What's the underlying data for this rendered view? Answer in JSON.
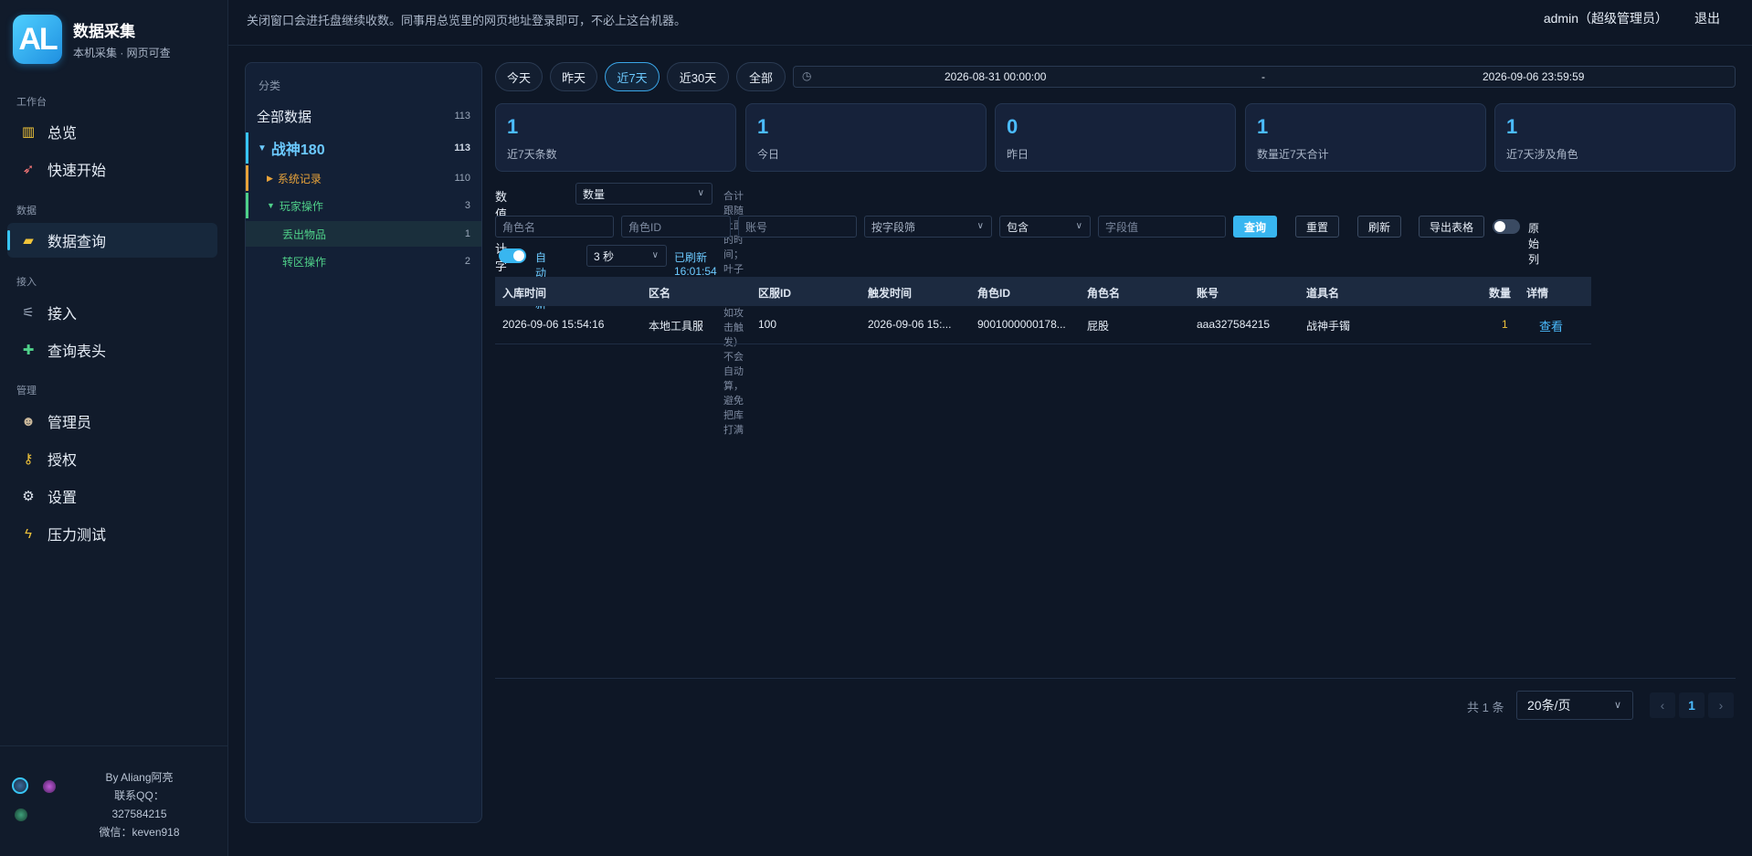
{
  "brand": {
    "logo": "AL",
    "title": "数据采集",
    "subtitle": "本机采集 · 网页可查"
  },
  "sidebar": {
    "groups": [
      "工作台",
      "数据",
      "接入",
      "管理"
    ],
    "items": [
      {
        "label": "总览",
        "icon": "bar-chart-icon"
      },
      {
        "label": "快速开始",
        "icon": "rocket-icon"
      },
      {
        "label": "数据查询",
        "icon": "folder-icon"
      },
      {
        "label": "接入",
        "icon": "plug-icon"
      },
      {
        "label": "查询表头",
        "icon": "puzzle-icon"
      },
      {
        "label": "管理员",
        "icon": "user-icon"
      },
      {
        "label": "授权",
        "icon": "key-icon"
      },
      {
        "label": "设置",
        "icon": "gear-icon"
      },
      {
        "label": "压力测试",
        "icon": "lightning-icon"
      }
    ],
    "footer": {
      "author": "By Aliang阿亮",
      "qq_label": "联系QQ：",
      "qq": "327584215",
      "wechat": "微信：keven918"
    }
  },
  "topbar": {
    "notice": "关闭窗口会进托盘继续收数。同事用总览里的网页地址登录即可，不必上这台机器。",
    "user": "admin（超级管理员）",
    "logout": "退出"
  },
  "categories": {
    "header": "分类",
    "items": [
      {
        "label": "全部数据",
        "count": "113"
      },
      {
        "label": "战神180",
        "count": "113"
      },
      {
        "label": "系统记录",
        "count": "110"
      },
      {
        "label": "玩家操作",
        "count": "3"
      },
      {
        "label": "丢出物品",
        "count": "1"
      },
      {
        "label": "转区操作",
        "count": "2"
      }
    ]
  },
  "filters": {
    "quick": [
      "今天",
      "昨天",
      "近7天",
      "近30天",
      "全部"
    ],
    "range_start": "2026-08-31 00:00:00",
    "range_sep": "-",
    "range_end": "2026-09-06 23:59:59",
    "sum_label": "数值合计字段",
    "sum_value": "数量",
    "sum_hint": "合计跟随上面的时间；叶子太大（例如攻击触发）不会自动算，避免把库打满",
    "ph_role_name": "角色名",
    "ph_role_id": "角色ID",
    "ph_account": "账号",
    "field_filter": "按字段筛",
    "match_mode": "包含",
    "ph_field_value": "字段值",
    "btn_query": "查询",
    "btn_reset": "重置",
    "btn_refresh": "刷新",
    "btn_export": "导出表格",
    "raw_columns": "原始列",
    "auto_refresh": "自动刷新",
    "interval": "3 秒",
    "refreshed": "已刷新 16:01:54"
  },
  "stats": [
    {
      "value": "1",
      "label": "近7天条数"
    },
    {
      "value": "1",
      "label": "今日"
    },
    {
      "value": "0",
      "label": "昨日"
    },
    {
      "value": "1",
      "label": "数量近7天合计"
    },
    {
      "value": "1",
      "label": "近7天涉及角色"
    }
  ],
  "table": {
    "columns": [
      "入库时间",
      "区名",
      "区服ID",
      "触发时间",
      "角色ID",
      "角色名",
      "账号",
      "道具名",
      "数量",
      "详情"
    ],
    "rows": [
      [
        "2026-09-06 15:54:16",
        "本地工具服",
        "100",
        "2026-09-06 15:...",
        "9001000000178...",
        "屁股",
        "aaa327584215",
        "战神手镯",
        "1",
        "查看"
      ]
    ]
  },
  "pager": {
    "total": "共 1 条",
    "size": "20条/页",
    "page": "1",
    "prev": "‹",
    "next": "›"
  },
  "colors": {
    "accent": "#38b6f0",
    "bg": "#0e1726",
    "orange": "#e8a33a",
    "green": "#4fd089",
    "yellow": "#f0c43a"
  }
}
